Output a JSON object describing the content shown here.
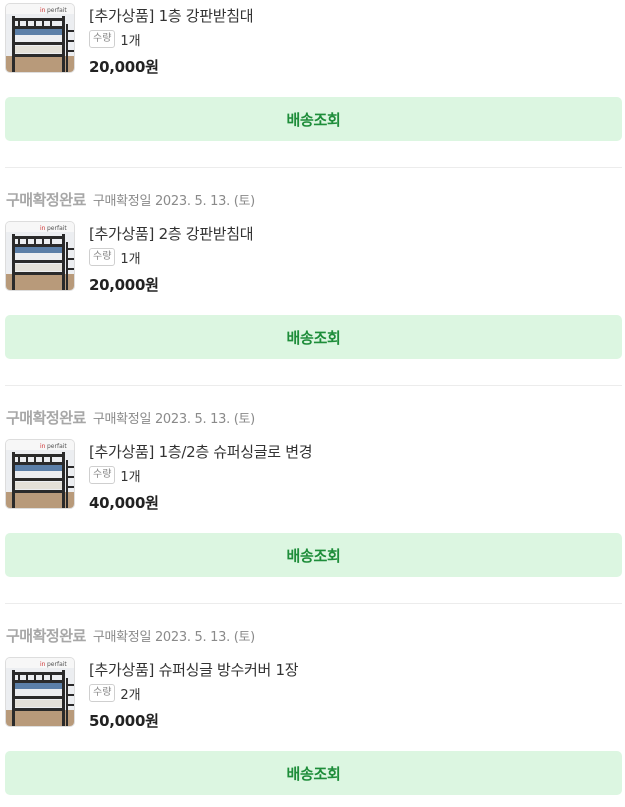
{
  "orders": [
    {
      "status": "",
      "confirm_text": "",
      "product_name": "[추가상품] 1층 강판받침대",
      "qty_badge": "수량",
      "qty_value": "1개",
      "price": "20,000원",
      "button": "배송조회"
    },
    {
      "status": "구매확정완료",
      "confirm_text": "구매확정일 2023. 5. 13. (토)",
      "product_name": "[추가상품] 2층 강판받침대",
      "qty_badge": "수량",
      "qty_value": "1개",
      "price": "20,000원",
      "button": "배송조회"
    },
    {
      "status": "구매확정완료",
      "confirm_text": "구매확정일 2023. 5. 13. (토)",
      "product_name": "[추가상품] 1층/2층 슈퍼싱글로 변경",
      "qty_badge": "수량",
      "qty_value": "1개",
      "price": "40,000원",
      "button": "배송조회"
    },
    {
      "status": "구매확정완료",
      "confirm_text": "구매확정일 2023. 5. 13. (토)",
      "product_name": "[추가상품] 슈퍼싱글 방수커버 1장",
      "qty_badge": "수량",
      "qty_value": "2개",
      "price": "50,000원",
      "button": "배송조회"
    }
  ],
  "thumbnail_brand": "inperfait",
  "colors": {
    "button_bg": "#dcf6e1",
    "button_text": "#1e8d3a",
    "status_text": "#a7a7a7"
  }
}
